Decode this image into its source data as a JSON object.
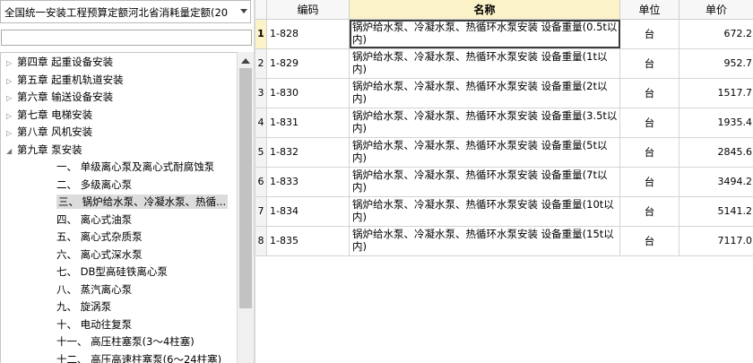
{
  "left_panel": {
    "quota_selector": {
      "value": "全国统一安装工程预算定额河北省消耗量定额(20"
    },
    "search": {
      "value": "",
      "placeholder": ""
    },
    "tree": {
      "chapters": [
        {
          "label": "第四章 起重设备安装",
          "expanded": false
        },
        {
          "label": "第五章 起重机轨道安装",
          "expanded": false
        },
        {
          "label": "第六章 输送设备安装",
          "expanded": false
        },
        {
          "label": "第七章 电梯安装",
          "expanded": false
        },
        {
          "label": "第八章 风机安装",
          "expanded": false
        },
        {
          "label": "第九章 泵安装",
          "expanded": true
        }
      ],
      "sections": [
        "一、 单级离心泵及离心式耐腐蚀泵",
        "二、 多级离心泵",
        "三、 锅炉给水泵、冷凝水泵、热循...",
        "四、 离心式油泵",
        "五、 离心式杂质泵",
        "六、 离心式深水泵",
        "七、 DB型高硅铁离心泵",
        "八、 蒸汽离心泵",
        "九、 旋涡泵",
        "十、 电动往复泵",
        "十一、 高压柱塞泵(3～4柱塞)",
        "十二、 高压高速柱塞泵(6～24柱塞)"
      ],
      "selected_section": "三、 锅炉给水泵、冷凝水泵、热循..."
    }
  },
  "grid": {
    "headers": {
      "code": "编码",
      "name": "名称",
      "unit": "单位",
      "price": "单价"
    },
    "rows": [
      {
        "no": "1",
        "code": "1-828",
        "name": "锅炉给水泵、冷凝水泵、热循环水泵安装 设备重量(0.5t以内)",
        "unit": "台",
        "price": "672.2"
      },
      {
        "no": "2",
        "code": "1-829",
        "name": "锅炉给水泵、冷凝水泵、热循环水泵安装 设备重量(1t以内)",
        "unit": "台",
        "price": "952.7"
      },
      {
        "no": "3",
        "code": "1-830",
        "name": "锅炉给水泵、冷凝水泵、热循环水泵安装 设备重量(2t以内)",
        "unit": "台",
        "price": "1517.7"
      },
      {
        "no": "4",
        "code": "1-831",
        "name": "锅炉给水泵、冷凝水泵、热循环水泵安装 设备重量(3.5t以内)",
        "unit": "台",
        "price": "1935.4"
      },
      {
        "no": "5",
        "code": "1-832",
        "name": "锅炉给水泵、冷凝水泵、热循环水泵安装 设备重量(5t以内)",
        "unit": "台",
        "price": "2845.6"
      },
      {
        "no": "6",
        "code": "1-833",
        "name": "锅炉给水泵、冷凝水泵、热循环水泵安装 设备重量(7t以内)",
        "unit": "台",
        "price": "3494.2"
      },
      {
        "no": "7",
        "code": "1-834",
        "name": "锅炉给水泵、冷凝水泵、热循环水泵安装 设备重量(10t以内)",
        "unit": "台",
        "price": "5141.2"
      },
      {
        "no": "8",
        "code": "1-835",
        "name": "锅炉给水泵、冷凝水泵、热循环水泵安装 设备重量(15t以内)",
        "unit": "台",
        "price": "7117.0"
      }
    ]
  },
  "colors": {
    "header_bg": "#f7f7f7",
    "active_header_bg": "#fbf2c8",
    "grid_line": "#d4d4d4",
    "tree_selected_bg": "#dcdcdc"
  },
  "icons": {
    "dropdown": "chevron-down-icon",
    "collapsed": "triangle-right-icon",
    "expanded": "triangle-down-icon",
    "scroll_up": "scroll-up-icon"
  }
}
